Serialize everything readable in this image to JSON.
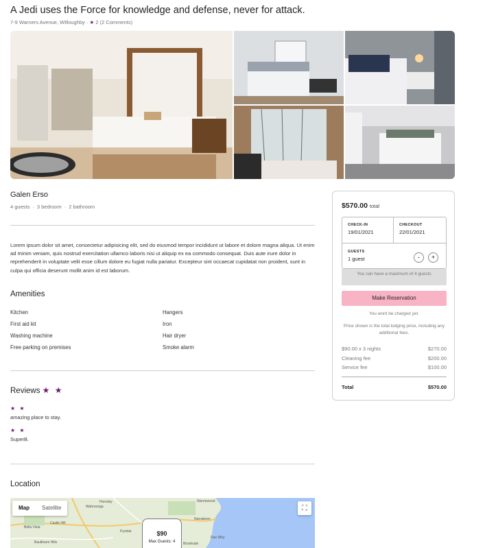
{
  "listing": {
    "title": "A Jedi uses the Force for knowledge and defense, never for attack.",
    "address": "7-9 Warners Avenue, Willoughby",
    "rating_star": "★",
    "rating": "2",
    "comments": "(2 Comments)"
  },
  "host": {
    "name": "Galen Erso",
    "guests": "4 guests",
    "bedrooms": "3 bedroom",
    "bathrooms": "2 bathroom"
  },
  "description": "Lorem ipsum dolor sit amet, consectetur adipisicing elit, sed do eiusmod tempor incididunt ut labore et dolore magna aliqua. Ut enim ad minim veniam, quis nostrud exercitation ullamco laboris nisi ut aliquip ex ea commodo consequat. Duis aute irure dolor in reprehenderit in voluptate velit esse cillum dolore eu fugiat nulla pariatur. Excepteur sint occaecat cupidatat non proident, sunt in culpa qui officia deserunt mollit anim id est laborum.",
  "amenities": {
    "heading": "Amenities",
    "left": [
      "Kitchen",
      "First aid kit",
      "Washing machine",
      "Free parking on premises"
    ],
    "right": [
      "Hangers",
      "Iron",
      "Hair dryer",
      "Smoke alarm"
    ]
  },
  "reviews": {
    "heading": "Reviews",
    "heading_stars": "★ ★",
    "items": [
      {
        "stars": "★ ★",
        "text": "amazing place to stay."
      },
      {
        "stars": "★ ★",
        "text": "SuperB."
      }
    ]
  },
  "location": {
    "heading": "Location",
    "map_tab": "Map",
    "satellite_tab": "Satellite",
    "marker_price": "$90",
    "marker_guests": "Max Guests: 4",
    "places": [
      "Wahroonga",
      "Hornsby",
      "Pymble",
      "Bella Vista",
      "Castle Hill",
      "Baulkham Hills",
      "Dee Why",
      "Brookvale",
      "Narrabeen",
      "Warriewood"
    ]
  },
  "booking": {
    "total_price": "$570.00",
    "total_label": "total",
    "checkin_label": "CHECK-IN",
    "checkin_value": "19/01/2021",
    "checkout_label": "CHECKOUT",
    "checkout_value": "22/01/2021",
    "guests_label": "GUESTS",
    "guests_value": "1 guest",
    "minus": "-",
    "plus": "+",
    "max_note": "You can have a maximum of 4 guests",
    "reserve_button": "Make Reservation",
    "not_charged": "You wont be charged yet.",
    "price_note": "Price shown is the total lodging price, including any additional fees.",
    "fees": [
      {
        "label": "$90.00 x 3 nights",
        "amount": "$270.00"
      },
      {
        "label": "Cleaning fee",
        "amount": "$200.00"
      },
      {
        "label": "Service fee",
        "amount": "$100.00"
      }
    ],
    "total_row_label": "Total",
    "total_row_amount": "$570.00"
  },
  "colors": {
    "star": "#6a1b6d",
    "reserve_button": "#f8b4c4"
  }
}
